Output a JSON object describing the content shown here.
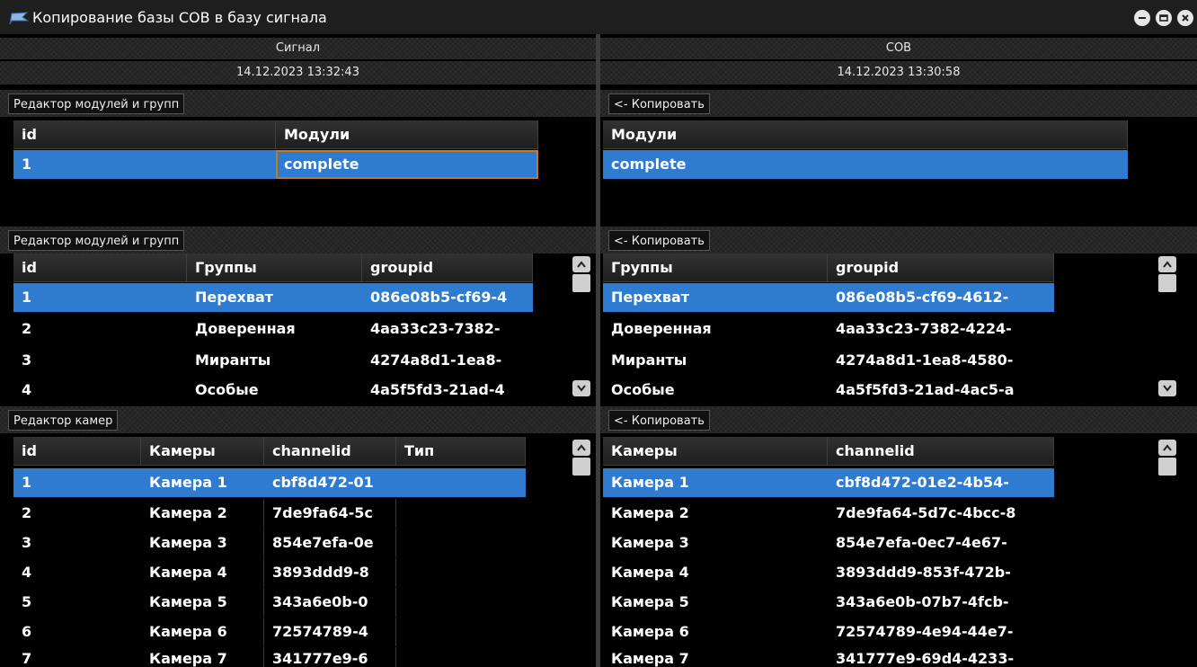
{
  "window": {
    "title": "Копирование базы СОВ в базу сигнала",
    "icons": [
      "flag-icon",
      "minimize-icon",
      "restore-icon",
      "close-icon"
    ]
  },
  "header": {
    "left_title": "Сигнал",
    "left_date": "14.12.2023 13:32:43",
    "right_title": "СОВ",
    "right_date": "14.12.2023 13:30:58"
  },
  "sections": {
    "modules_left_button": "Редактор модулей и групп",
    "modules_right_button": "<- Копировать",
    "groups_left_button": "Редактор модулей и групп",
    "groups_right_button": "<- Копировать",
    "cameras_left_button": "Редактор камер",
    "cameras_right_button": "<- Копировать"
  },
  "modules_left": {
    "columns": [
      "id",
      "Модули"
    ],
    "rows": [
      [
        "1",
        "complete"
      ]
    ]
  },
  "modules_right": {
    "columns": [
      "Модули"
    ],
    "rows": [
      [
        "complete"
      ]
    ]
  },
  "groups_left": {
    "columns": [
      "id",
      "Группы",
      "groupid"
    ],
    "rows": [
      [
        "1",
        "Перехват",
        "086e08b5-cf69-4"
      ],
      [
        "2",
        "Доверенная",
        "4aa33c23-7382-"
      ],
      [
        "3",
        "Миранты",
        "4274a8d1-1ea8-"
      ],
      [
        "4",
        "Особые",
        "4a5f5fd3-21ad-4"
      ]
    ]
  },
  "groups_right": {
    "columns": [
      "Группы",
      "groupid"
    ],
    "rows": [
      [
        "Перехват",
        "086e08b5-cf69-4612-"
      ],
      [
        "Доверенная",
        "4aa33c23-7382-4224-"
      ],
      [
        "Миранты",
        "4274a8d1-1ea8-4580-"
      ],
      [
        "Особые",
        "4a5f5fd3-21ad-4ac5-a"
      ]
    ]
  },
  "cameras_left": {
    "columns": [
      "id",
      "Камеры",
      "channelid",
      "Тип"
    ],
    "rows": [
      [
        "1",
        "Камера 1",
        "cbf8d472-01",
        ""
      ],
      [
        "2",
        "Камера 2",
        "7de9fa64-5c",
        ""
      ],
      [
        "3",
        "Камера 3",
        "854e7efa-0e",
        ""
      ],
      [
        "4",
        "Камера 4",
        "3893ddd9-8",
        ""
      ],
      [
        "5",
        "Камера 5",
        "343a6e0b-0",
        ""
      ],
      [
        "6",
        "Камера 6",
        "72574789-4",
        ""
      ],
      [
        "7",
        "Камера 7",
        "341777e9-6",
        ""
      ]
    ]
  },
  "cameras_right": {
    "columns": [
      "Камеры",
      "channelid"
    ],
    "rows": [
      [
        "Камера 1",
        "cbf8d472-01e2-4b54-"
      ],
      [
        "Камера 2",
        "7de9fa64-5d7c-4bcc-8"
      ],
      [
        "Камера 3",
        "854e7efa-0ec7-4e67-"
      ],
      [
        "Камера 4",
        "3893ddd9-853f-472b-"
      ],
      [
        "Камера 5",
        "343a6e0b-07b7-4fcb-"
      ],
      [
        "Камера 6",
        "72574789-4e94-44e7-"
      ],
      [
        "Камера 7",
        "341777e9-69d4-4233-"
      ]
    ]
  },
  "colors": {
    "selection": "#2f7bd0",
    "focus_border": "#c8791a",
    "background": "#000000",
    "header_bg": "#222222"
  }
}
